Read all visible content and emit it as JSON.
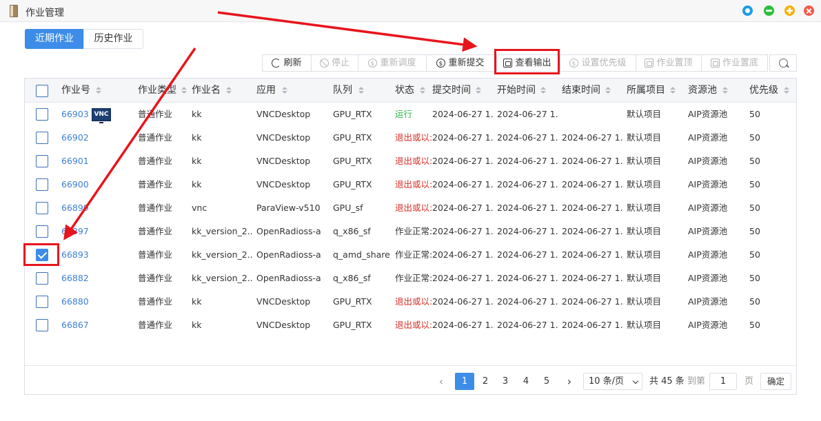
{
  "window": {
    "title": "作业管理"
  },
  "tabs": [
    {
      "label": "近期作业",
      "active": true
    },
    {
      "label": "历史作业",
      "active": false
    }
  ],
  "toolbar": {
    "refresh": "刷新",
    "stop": "停止",
    "reschedule": "重新调度",
    "resubmit": "重新提交",
    "view_output": "查看输出",
    "set_priority": "设置优先级",
    "pin_top": "作业置顶",
    "pin_bottom": "作业置底"
  },
  "table": {
    "headers": [
      "作业号",
      "作业类型",
      "作业名",
      "应用",
      "队列",
      "状态",
      "提交时间",
      "开始时间",
      "结束时间",
      "所属项目",
      "资源池",
      "优先级"
    ],
    "rows": [
      {
        "id": "66903",
        "type": "普通作业",
        "name": "kk",
        "app": "VNCDesktop",
        "queue": "GPU_RTX",
        "status": "运行",
        "status_kind": "running",
        "submit": "2024-06-27 1...",
        "start": "2024-06-27 1...",
        "end": "",
        "project": "默认项目",
        "pool": "AIP资源池",
        "priority": "50",
        "vnc": "VNC",
        "checked": false
      },
      {
        "id": "66902",
        "type": "普通作业",
        "name": "kk",
        "app": "VNCDesktop",
        "queue": "GPU_RTX",
        "status": "退出或以:",
        "status_kind": "exited",
        "submit": "2024-06-27 1...",
        "start": "2024-06-27 1...",
        "end": "2024-06-27 1...",
        "project": "默认项目",
        "pool": "AIP资源池",
        "priority": "50",
        "checked": false
      },
      {
        "id": "66901",
        "type": "普通作业",
        "name": "kk",
        "app": "VNCDesktop",
        "queue": "GPU_RTX",
        "status": "退出或以:",
        "status_kind": "exited",
        "submit": "2024-06-27 1...",
        "start": "2024-06-27 1...",
        "end": "2024-06-27 1...",
        "project": "默认项目",
        "pool": "AIP资源池",
        "priority": "50",
        "checked": false
      },
      {
        "id": "66900",
        "type": "普通作业",
        "name": "kk",
        "app": "VNCDesktop",
        "queue": "GPU_RTX",
        "status": "退出或以:",
        "status_kind": "exited",
        "submit": "2024-06-27 1...",
        "start": "2024-06-27 1...",
        "end": "2024-06-27 1...",
        "project": "默认项目",
        "pool": "AIP资源池",
        "priority": "50",
        "checked": false
      },
      {
        "id": "66899",
        "type": "普通作业",
        "name": "vnc",
        "app": "ParaView-v510",
        "queue": "GPU_sf",
        "status": "退出或以:",
        "status_kind": "exited",
        "submit": "2024-06-27 1...",
        "start": "2024-06-27 1...",
        "end": "2024-06-27 1...",
        "project": "默认项目",
        "pool": "AIP资源池",
        "priority": "50",
        "checked": false
      },
      {
        "id": "66897",
        "type": "普通作业",
        "name": "kk_version_2...",
        "app": "OpenRadioss-a",
        "queue": "q_x86_sf",
        "status": "作业正常:",
        "status_kind": "normal",
        "submit": "2024-06-27 1...",
        "start": "2024-06-27 1...",
        "end": "2024-06-27 1...",
        "project": "默认项目",
        "pool": "AIP资源池",
        "priority": "50",
        "checked": false
      },
      {
        "id": "66893",
        "type": "普通作业",
        "name": "kk_version_2...",
        "app": "OpenRadioss-a",
        "queue": "q_amd_share",
        "status": "作业正常:",
        "status_kind": "normal",
        "submit": "2024-06-27 1...",
        "start": "2024-06-27 1...",
        "end": "2024-06-27 1...",
        "project": "默认项目",
        "pool": "AIP资源池",
        "priority": "50",
        "checked": true
      },
      {
        "id": "66882",
        "type": "普通作业",
        "name": "kk_version_2...",
        "app": "OpenRadioss-a",
        "queue": "q_x86_sf",
        "status": "作业正常:",
        "status_kind": "normal",
        "submit": "2024-06-27 1...",
        "start": "2024-06-27 1...",
        "end": "2024-06-27 1...",
        "project": "默认项目",
        "pool": "AIP资源池",
        "priority": "50",
        "checked": false
      },
      {
        "id": "66880",
        "type": "普通作业",
        "name": "kk",
        "app": "VNCDesktop",
        "queue": "GPU_RTX",
        "status": "退出或以:",
        "status_kind": "exited",
        "submit": "2024-06-27 1...",
        "start": "2024-06-27 1...",
        "end": "2024-06-27 1...",
        "project": "默认项目",
        "pool": "AIP资源池",
        "priority": "50",
        "checked": false
      },
      {
        "id": "66867",
        "type": "普通作业",
        "name": "kk",
        "app": "VNCDesktop",
        "queue": "GPU_RTX",
        "status": "退出或以:",
        "status_kind": "exited",
        "submit": "2024-06-27 1...",
        "start": "2024-06-27 1...",
        "end": "2024-06-27 1...",
        "project": "默认项目",
        "pool": "AIP资源池",
        "priority": "50",
        "checked": false
      }
    ]
  },
  "pagination": {
    "pages": [
      "1",
      "2",
      "3",
      "4",
      "5"
    ],
    "current": "1",
    "page_size": "10 条/页",
    "total": "共 45 条",
    "goto_label": "到第",
    "goto_value": "1",
    "page_suffix": "页",
    "confirm": "确定"
  },
  "colors": {
    "accent": "#3d8de8",
    "link": "#3d7fd6",
    "running": "#2db84d",
    "exited": "#d9302a",
    "annotation": "#e8141c"
  }
}
